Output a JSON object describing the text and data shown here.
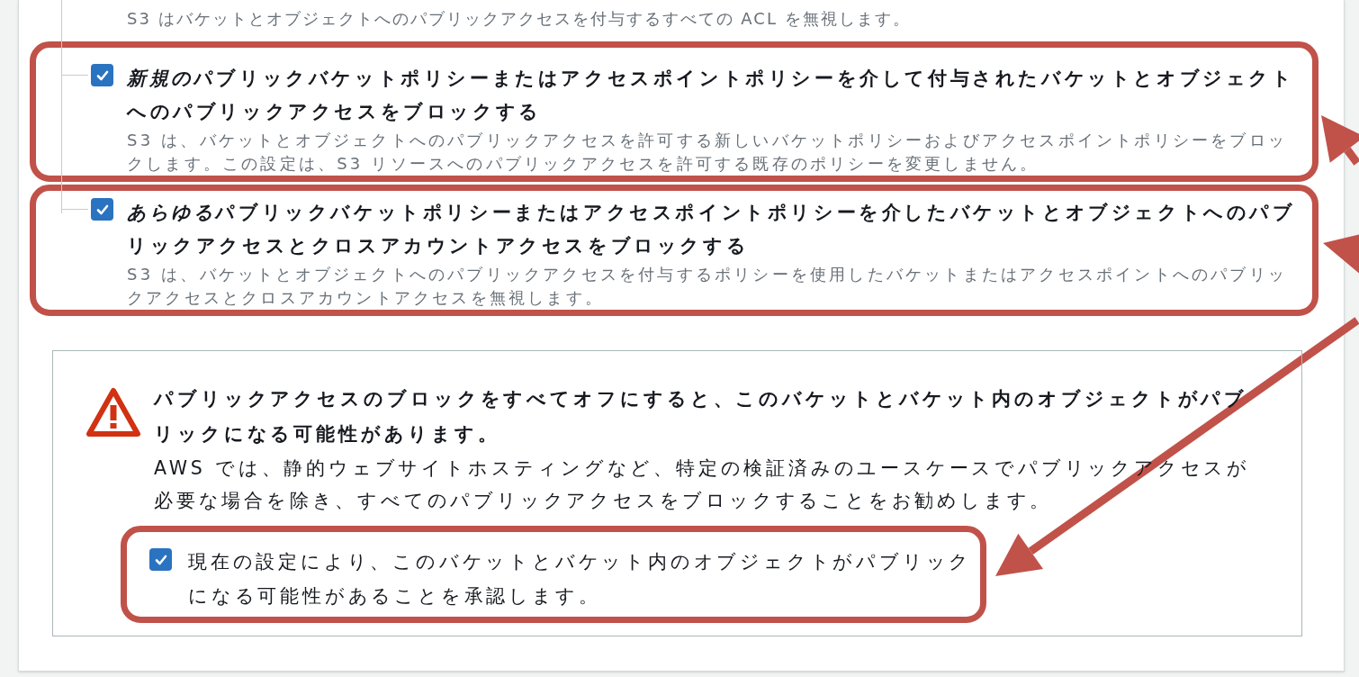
{
  "previous_option": {
    "description": "S3 はバケットとオブジェクトへのパブリックアクセスを付与するすべての ACL を無視します。"
  },
  "options": [
    {
      "emphasis": "新規の",
      "title": "パブリックバケットポリシーまたはアクセスポイントポリシーを介して付与されたバケットとオブジェクトへのパブリックアクセスをブロックする",
      "description": "S3 は、バケットとオブジェクトへのパブリックアクセスを許可する新しいバケットポリシーおよびアクセスポイントポリシーをブロックします。この設定は、S3 リソースへのパブリックアクセスを許可する既存のポリシーを変更しません。",
      "checked": true,
      "highlighted": true
    },
    {
      "emphasis": "あらゆる",
      "title": "パブリックバケットポリシーまたはアクセスポイントポリシーを介したバケットとオブジェクトへのパブリックアクセスとクロスアカウントアクセスをブロックする",
      "description": "S3 は、バケットとオブジェクトへのパブリックアクセスを付与するポリシーを使用したバケットまたはアクセスポイントへのパブリックアクセスとクロスアカウントアクセスを無視します。",
      "checked": true,
      "highlighted": true
    }
  ],
  "warning": {
    "title": "パブリックアクセスのブロックをすべてオフにすると、このバケットとバケット内のオブジェクトがパブリックになる可能性があります。",
    "body": "AWS では、静的ウェブサイトホスティングなど、特定の検証済みのユースケースでパブリックアクセスが必要な場合を除き、すべてのパブリックアクセスをブロックすることをお勧めします。",
    "acknowledgement": {
      "label": "現在の設定により、このバケットとバケット内のオブジェクトがパブリックになる可能性があることを承認します。",
      "checked": true,
      "highlighted": true
    }
  }
}
